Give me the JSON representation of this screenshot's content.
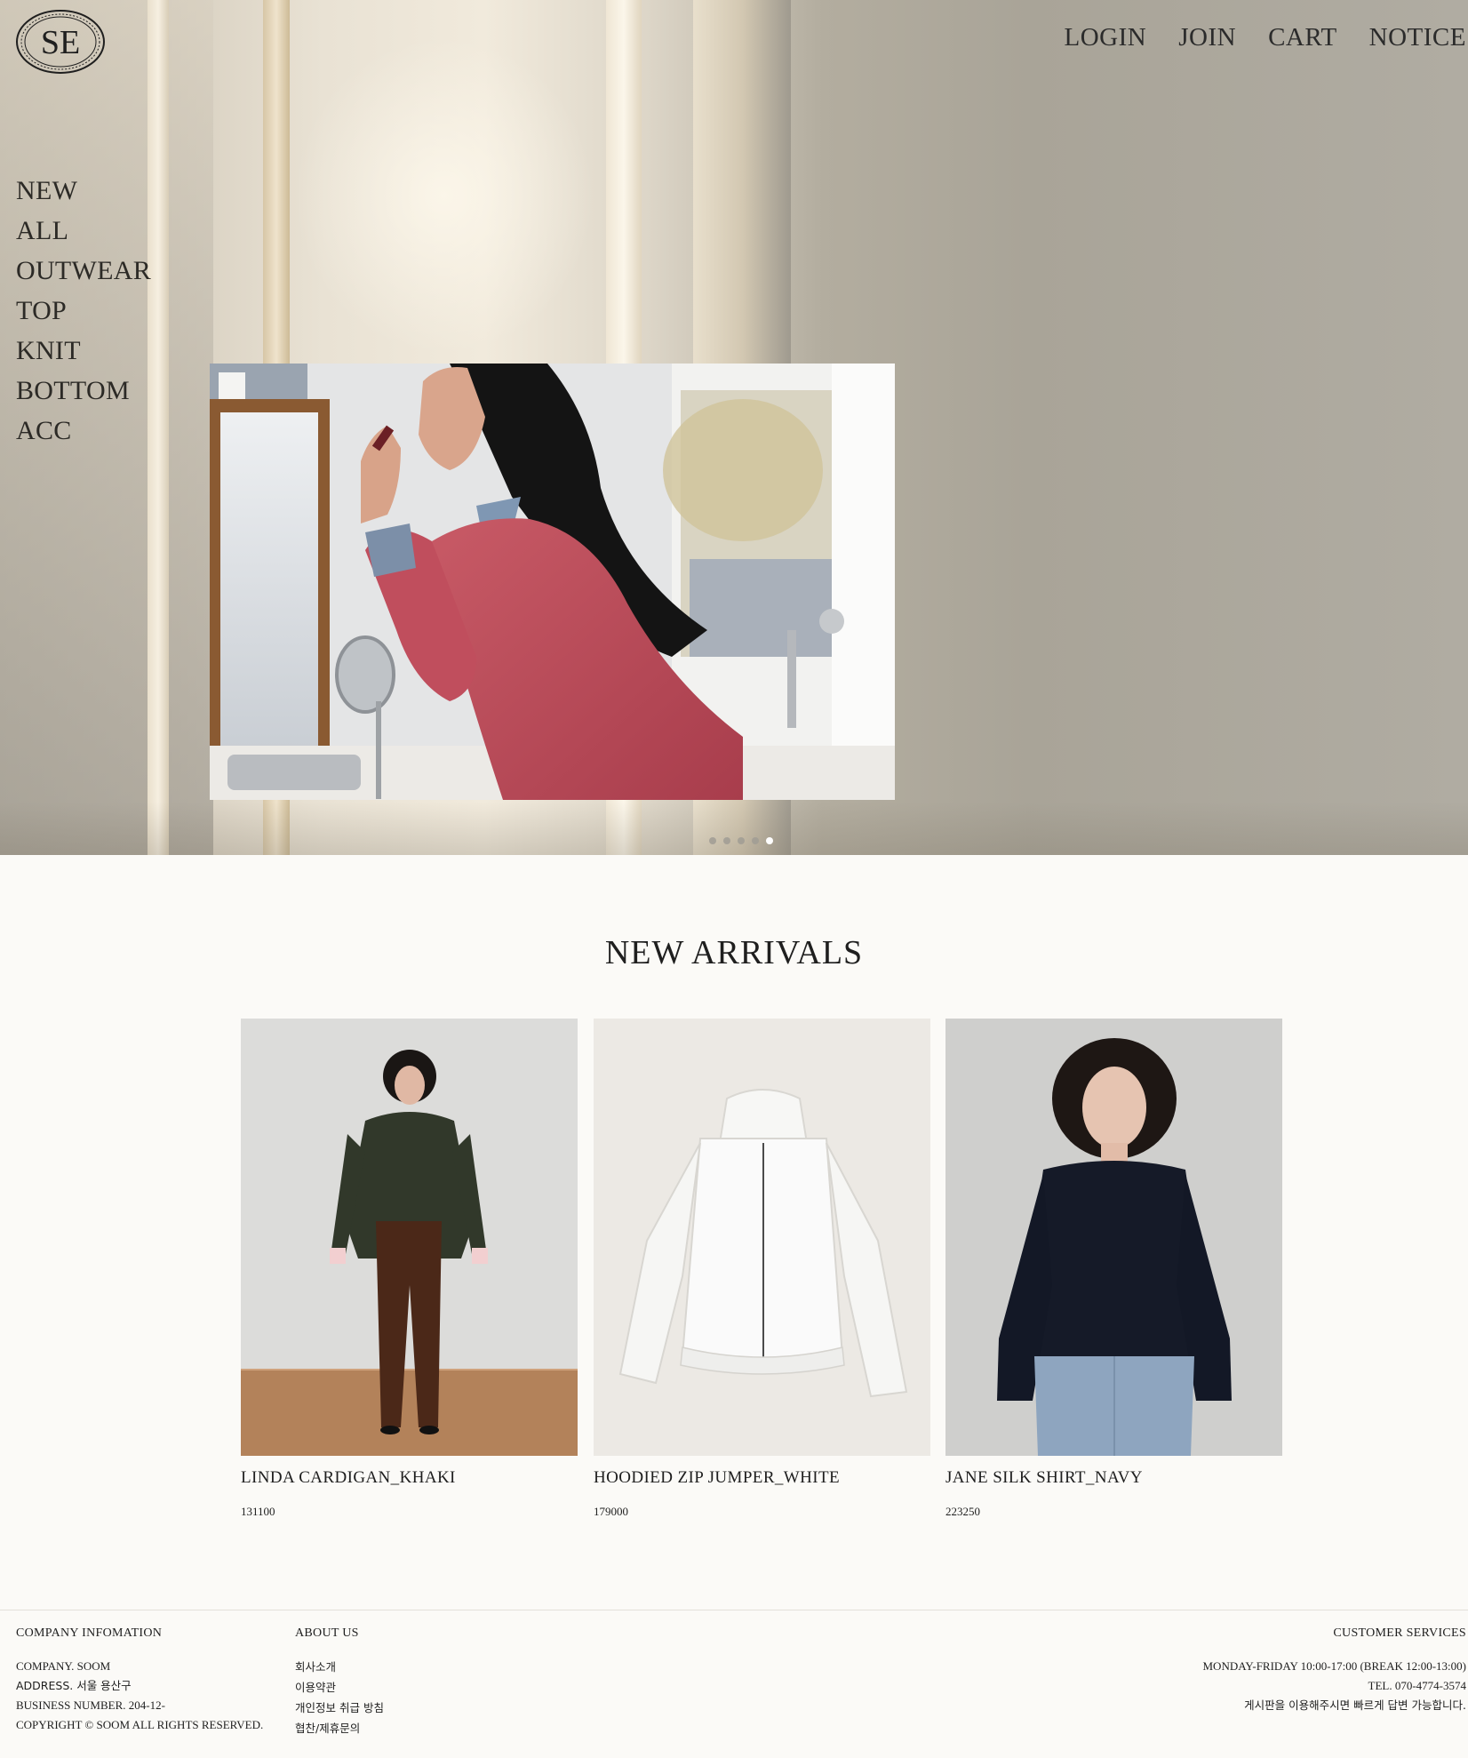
{
  "brand": {
    "logo_text": "SE",
    "logo_icon": "monogram-seal"
  },
  "top_nav": [
    {
      "label": "LOGIN"
    },
    {
      "label": "JOIN"
    },
    {
      "label": "CART"
    },
    {
      "label": "NOTICE"
    }
  ],
  "side_nav": [
    {
      "label": "NEW"
    },
    {
      "label": "ALL"
    },
    {
      "label": "OUTWEAR"
    },
    {
      "label": "TOP"
    },
    {
      "label": "KNIT"
    },
    {
      "label": "BOTTOM"
    },
    {
      "label": "ACC"
    }
  ],
  "slider": {
    "total_slides": 5,
    "active_index": 4
  },
  "new_arrivals": {
    "title": "NEW ARRIVALS",
    "products": [
      {
        "name": "LINDA CARDIGAN_KHAKI",
        "price": "131100"
      },
      {
        "name": "HOODIED ZIP JUMPER_WHITE",
        "price": "179000"
      },
      {
        "name": "JANE SILK SHIRT_NAVY",
        "price": "223250"
      }
    ]
  },
  "footer": {
    "company": {
      "heading": "COMPANY INFOMATION",
      "lines": [
        "COMPANY. SOOM",
        "ADDRESS. 서울 용산구",
        "BUSINESS NUMBER. 204-12-",
        "COPYRIGHT © SOOM ALL RIGHTS RESERVED."
      ]
    },
    "about": {
      "heading": "ABOUT US",
      "links": [
        "회사소개",
        "이용약관",
        "개인정보 취급 방침",
        "협찬/제휴문의"
      ]
    },
    "customer": {
      "heading": "CUSTOMER SERVICES",
      "lines": [
        "MONDAY-FRIDAY 10:00-17:00 (BREAK 12:00-13:00)",
        "TEL. 070-4774-3574",
        "게시판을 이용해주시면 빠르게 답변 가능합니다."
      ]
    }
  }
}
